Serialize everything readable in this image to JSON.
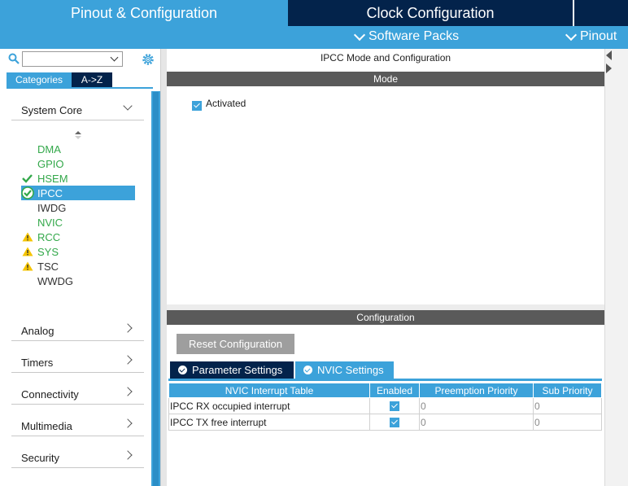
{
  "top_tabs": {
    "pinout": "Pinout & Configuration",
    "clock": "Clock Configuration"
  },
  "subbar": {
    "software_packs": "Software Packs",
    "pinout": "Pinout"
  },
  "left_panel": {
    "search_value": "",
    "categories_button": "Categories",
    "az_button": "A->Z",
    "system_core": {
      "label": "System Core",
      "items": [
        {
          "label": "DMA",
          "status": "",
          "color": "green"
        },
        {
          "label": "GPIO",
          "status": "",
          "color": "green"
        },
        {
          "label": "HSEM",
          "status": "check",
          "color": "green"
        },
        {
          "label": "IPCC",
          "status": "check-circle",
          "color": "selected"
        },
        {
          "label": "IWDG",
          "status": "",
          "color": "dark"
        },
        {
          "label": "NVIC",
          "status": "",
          "color": "green"
        },
        {
          "label": "RCC",
          "status": "warning",
          "color": "green"
        },
        {
          "label": "SYS",
          "status": "warning",
          "color": "green"
        },
        {
          "label": "TSC",
          "status": "warning",
          "color": "dark"
        },
        {
          "label": "WWDG",
          "status": "",
          "color": "dark"
        }
      ]
    },
    "categories": [
      "Analog",
      "Timers",
      "Connectivity",
      "Multimedia",
      "Security"
    ]
  },
  "mode_panel": {
    "title": "IPCC Mode and Configuration",
    "mode_header": "Mode",
    "activated_label": "Activated",
    "activated": true
  },
  "config_panel": {
    "header": "Configuration",
    "reset_button": "Reset Configuration",
    "tabs": [
      "Parameter Settings",
      "NVIC Settings"
    ],
    "table": {
      "columns": [
        "NVIC Interrupt Table",
        "Enabled",
        "Preemption Priority",
        "Sub Priority"
      ],
      "rows": [
        {
          "name": "IPCC RX occupied interrupt",
          "enabled": true,
          "preemption": "0",
          "sub": "0"
        },
        {
          "name": "IPCC TX free interrupt",
          "enabled": true,
          "preemption": "0",
          "sub": "0"
        }
      ]
    }
  },
  "colors": {
    "accent_blue": "#3ca2da",
    "navy": "#03234b",
    "header_gray": "#5a5a5a",
    "ok_green": "#33a84a",
    "warning_yellow": "#f5c400"
  }
}
